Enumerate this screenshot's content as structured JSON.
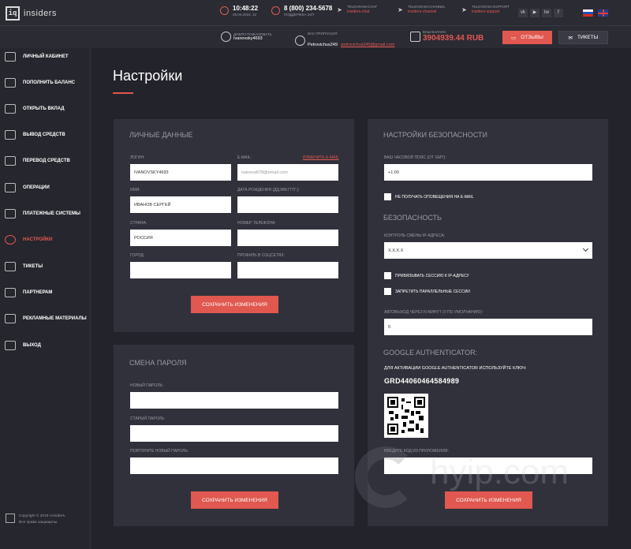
{
  "brand": {
    "logo_mark": "[iq]",
    "name": "insiders"
  },
  "topbar": {
    "time": "10:48:22",
    "date": "25.04.2019, 12",
    "phone": "8 (800) 234-5678",
    "phone_sub": "ПОДДЕРЖКА 24/7",
    "telegram_chat_label": "TELEGRAM-CHAT",
    "telegram_chat_link": "insiders-chat",
    "telegram_channel_label": "TELEGRAM-CHANNEL",
    "telegram_channel_link": "insiders-channel",
    "telegram_support_label": "TELEGRAM-SUPPORT",
    "telegram_support_link": "insiders-support",
    "social": [
      "vk",
      "▶",
      "tw",
      "f"
    ]
  },
  "subbar": {
    "welcome_label": "ДОБРО ПОЖАЛОВАТЬ",
    "welcome_user": "Ivanovsky4693",
    "invited_label": "ВАС ПРИГЛАСИЛ:",
    "invited_user": "Petrovichus249",
    "invited_email": "petrovichus249@gmail.com",
    "balance_label": "ВАШ БАЛАНС",
    "balance_value": "3904939.44 RUB",
    "reviews_btn": "ОТЗЫВЫ",
    "tickets_btn": "ТИКЕТЫ"
  },
  "sidebar": {
    "items": [
      {
        "label": "ЛИЧНЫЙ КАБИНЕТ",
        "icon": "id-card-icon"
      },
      {
        "label": "ПОПОЛНИТЬ БАЛАНС",
        "icon": "coins-up-icon"
      },
      {
        "label": "ОТКРЫТЬ ВКЛАД",
        "icon": "safe-icon"
      },
      {
        "label": "ВЫВОД СРЕДСТВ",
        "icon": "coins-down-icon"
      },
      {
        "label": "ПЕРЕВОД СРЕДСТВ",
        "icon": "transfer-icon"
      },
      {
        "label": "ОПЕРАЦИИ",
        "icon": "calendar-icon"
      },
      {
        "label": "ПЛАТЕЖНЫЕ СИСТЕМЫ",
        "icon": "wallet-icon"
      },
      {
        "label": "НАСТРОЙКИ",
        "icon": "gear-icon"
      },
      {
        "label": "ТИКЕТЫ",
        "icon": "envelope-icon"
      },
      {
        "label": "ПАРТНЕРАМ",
        "icon": "partners-icon"
      },
      {
        "label": "РЕКЛАМНЫЕ МАТЕРИАЛЫ",
        "icon": "ad-icon"
      },
      {
        "label": "ВЫХОД",
        "icon": "logout-icon"
      }
    ],
    "copyright_line1": "Copyright © 2019 i-insiders.",
    "copyright_line2": "Все права защищены."
  },
  "page": {
    "title": "Настройки"
  },
  "personal": {
    "title": "ЛИЧНЫЕ ДАННЫЕ",
    "login_label": "ЛОГИН:",
    "login_value": "IVANOVSKY4693",
    "email_label": "E-MAIL:",
    "email_change": "ИЗМЕНИТЬ E-MAIL",
    "email_value": "ivanova678@email.com",
    "name_label": "ИМЯ:",
    "name_value": "ИВАНОВ СЕРГЕЙ",
    "birth_label": "ДАТА РОЖДЕНИЯ (ДД.ММ.ГГГГ.):",
    "country_label": "СТРАНА:",
    "country_value": "РОССИЯ",
    "phone_label": "НОМЕР ТЕЛЕФОНА:",
    "city_label": "ГОРОД:",
    "social_label": "ПРОФИЛЬ В СОЦСЕТЯХ:",
    "save_btn": "СОХРАНИТЬ ИЗМЕНЕНИЯ"
  },
  "password": {
    "title": "СМЕНА ПАРОЛЯ",
    "new_label": "НОВЫЙ ПАРОЛЬ:",
    "old_label": "СТАРЫЙ ПАРОЛЬ:",
    "repeat_label": "ПОВТОРИТЕ НОВЫЙ ПАРОЛЬ:",
    "save_btn": "СОХРАНИТЬ ИЗМЕНЕНИЯ"
  },
  "security": {
    "title": "НАСТРОЙКИ БЕЗОПАСНОСТИ",
    "tz_label": "ВАШ ЧАСОВОЙ ПОЯС (ОТ GMT):",
    "tz_value": "+1:00",
    "no_email_notify": "НЕ ПОЛУЧАТЬ ОПОВЕЩЕНИЯ НА E-MAIL",
    "section_title": "БЕЗОПАСНОСТЬ",
    "ip_label": "КОНТРОЛЬ СМЕНЫ IP-АДРЕСА:",
    "ip_value": "X.X.X.X",
    "bind_session": "ПРИВЯЗЫВАТЬ СЕССИЮ К IP-АДРЕСУ",
    "forbid_parallel": "ЗАПРЕТИТЬ ПАРАЛЛЕЛЬНЫЕ СЕССИИ",
    "autologout_label": "АВТОВЫХОД ЧЕРЕЗ N МИНУТ (0 ПО УМОЛЧАНИЮ):",
    "autologout_value": "0",
    "ga_title": "GOOGLE AUTHENTICATOR:",
    "ga_key_label": "ДЛЯ АКТИВАЦИИ GOOGLE AUTHENTICATOR ИСПОЛЬЗУЙТЕ КЛЮЧ:",
    "ga_key": "GRD44060464584989",
    "ga_code_label": "ВВЕДИТЕ КОД ИЗ ПРИЛОЖЕНИЯ:",
    "save_btn": "СОХРАНИТЬ ИЗМЕНЕНИЯ"
  },
  "watermark": "hyip.com"
}
